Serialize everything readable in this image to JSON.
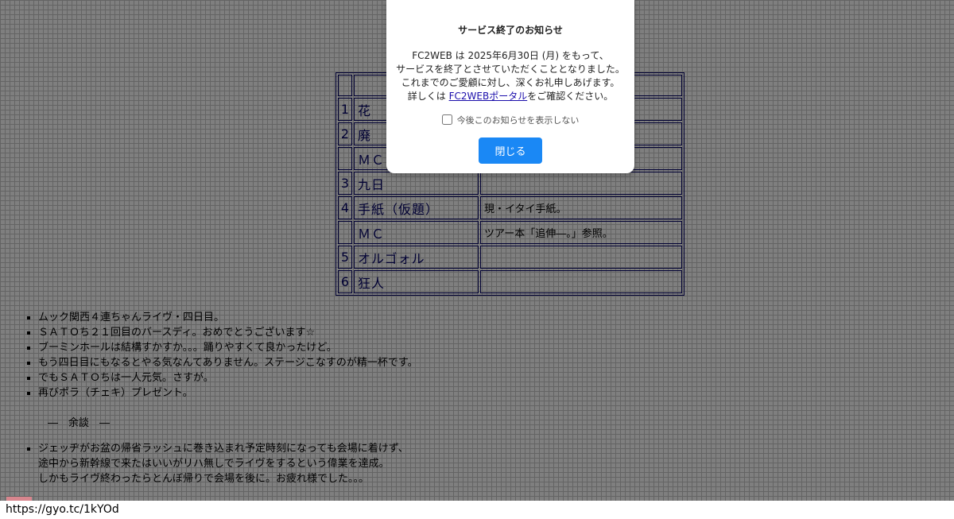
{
  "setlist": {
    "rows": [
      {
        "num": "1",
        "title": "花",
        "note": ""
      },
      {
        "num": "2",
        "title": "廃",
        "note": ""
      },
      {
        "num": "",
        "title": "ＭＣ",
        "note": ""
      },
      {
        "num": "3",
        "title": "九日",
        "note": ""
      },
      {
        "num": "4",
        "title": "手紙（仮題）",
        "note": "現・イタイ手紙。"
      },
      {
        "num": "",
        "title": "ＭＣ",
        "note": "ツアー本「追伸―。」参照。"
      },
      {
        "num": "5",
        "title": "オルゴォル",
        "note": ""
      },
      {
        "num": "6",
        "title": "狂人",
        "note": ""
      }
    ]
  },
  "notes1": [
    "ムック関西４連ちゃんライヴ・四日目。",
    "ＳＡＴＯち２１回目のバースディ。おめでとうございます☆",
    "ブーミンホールは結構すかすか。。。踊りやすくて良かったけど。",
    "もう四日目にもなるとやる気なんてありません。ステージこなすのが精一杯です。",
    "でもＳＡＴＯちは一人元気。さすが。",
    "再びポラ（チェキ）プレゼント。"
  ],
  "yodan": "―　余談　―",
  "notes2": {
    "line1": "ジェッヂがお盆の帰省ラッシュに巻き込まれ予定時刻になっても会場に着けず、",
    "line2": "途中から新幹線で来たはいいがリハ無しでライヴをするという偉業を達成。",
    "line3": "しかもライヴ終わったらとんぼ帰りで会場を後に。お疲れ様でした。。。"
  },
  "modal": {
    "title": "サービス終了のお知らせ",
    "line1": "FC2WEB は 2025年6月30日 (月) をもって、",
    "line2": "サービスを終了とさせていただくこととなりました。",
    "line3": "これまでのご愛顧に対し、深くお礼申しあげます。",
    "line4_pre": "詳しくは ",
    "link": "FC2WEBポータル",
    "line4_post": "をご確認ください。",
    "checkbox_label": "今後このお知らせを表示しない",
    "close_label": "閉じる"
  },
  "status_url": "https://gyo.tc/1kYOd",
  "colors": {
    "table_border": "#000066",
    "button": "#1a88f5",
    "overlay": "rgba(0,0,0,0.5)"
  }
}
